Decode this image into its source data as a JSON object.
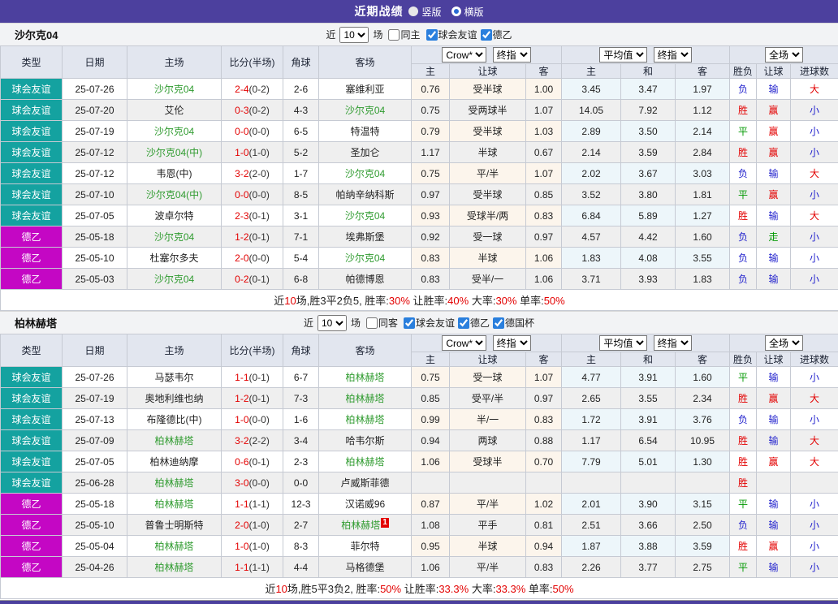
{
  "topbar": {
    "title": "近期战绩",
    "layout_options": [
      {
        "label": "竖版",
        "selected": true
      },
      {
        "label": "横版",
        "selected": false
      }
    ]
  },
  "palette": {
    "topbar_purple": "#4c409e",
    "type_friendly_teal": "#14a2a0",
    "type_league_magenta": "#c407c4",
    "focus_team_green": "#2f9b2f",
    "score_red": "#e30000",
    "result_red": "#e30000",
    "result_blue": "#2323cd",
    "result_green": "#029902",
    "crow_col_bg": "#fcf5ec",
    "avg_col_bg": "#edf6fa"
  },
  "head": {
    "type": "类型",
    "date": "日期",
    "home": "主场",
    "score": "比分(半场)",
    "corner": "角球",
    "away": "客场",
    "crow_home": "主",
    "crow_handicap": "让球",
    "crow_away": "客",
    "avg_home": "主",
    "avg_draw": "和",
    "avg_away": "客",
    "result_wl": "胜负",
    "result_handicap": "让球",
    "result_goals": "进球数",
    "crow_select": "Crow*",
    "final_select": "终指",
    "avg_select": "平均值",
    "scope_select": "全场"
  },
  "sections": [
    {
      "team": "沙尔克04",
      "controls": {
        "near": "近",
        "count": "10",
        "suffix": "场",
        "same": "同主",
        "leagues": [
          {
            "label": "球会友谊",
            "checked": true
          },
          {
            "label": "德乙",
            "checked": true
          }
        ]
      },
      "rows": [
        {
          "type": "球会友谊",
          "date": "25-07-26",
          "home": "沙尔克04",
          "home_green": true,
          "score": "2-4",
          "half": "(0-2)",
          "corner": "2-6",
          "away": "塞维利亚",
          "away_green": false,
          "away_badge": "",
          "crow": [
            "0.76",
            "受半球",
            "1.00"
          ],
          "avg": [
            "3.45",
            "3.47",
            "1.97"
          ],
          "res": [
            "负",
            "输",
            "大"
          ]
        },
        {
          "type": "球会友谊",
          "date": "25-07-20",
          "home": "艾伦",
          "home_green": false,
          "score": "0-3",
          "half": "(0-2)",
          "corner": "4-3",
          "away": "沙尔克04",
          "away_green": true,
          "away_badge": "",
          "crow": [
            "0.75",
            "受两球半",
            "1.07"
          ],
          "avg": [
            "14.05",
            "7.92",
            "1.12"
          ],
          "res": [
            "胜",
            "赢",
            "小"
          ]
        },
        {
          "type": "球会友谊",
          "date": "25-07-19",
          "home": "沙尔克04",
          "home_green": true,
          "score": "0-0",
          "half": "(0-0)",
          "corner": "6-5",
          "away": "特温特",
          "away_green": false,
          "away_badge": "",
          "crow": [
            "0.79",
            "受半球",
            "1.03"
          ],
          "avg": [
            "2.89",
            "3.50",
            "2.14"
          ],
          "res": [
            "平",
            "赢",
            "小"
          ]
        },
        {
          "type": "球会友谊",
          "date": "25-07-12",
          "home": "沙尔克04(中)",
          "home_green": true,
          "score": "1-0",
          "half": "(1-0)",
          "corner": "5-2",
          "away": "圣加仑",
          "away_green": false,
          "away_badge": "",
          "crow": [
            "1.17",
            "半球",
            "0.67"
          ],
          "avg": [
            "2.14",
            "3.59",
            "2.84"
          ],
          "res": [
            "胜",
            "赢",
            "小"
          ]
        },
        {
          "type": "球会友谊",
          "date": "25-07-12",
          "home": "韦恩(中)",
          "home_green": false,
          "score": "3-2",
          "half": "(2-0)",
          "corner": "1-7",
          "away": "沙尔克04",
          "away_green": true,
          "away_badge": "",
          "crow": [
            "0.75",
            "平/半",
            "1.07"
          ],
          "avg": [
            "2.02",
            "3.67",
            "3.03"
          ],
          "res": [
            "负",
            "输",
            "大"
          ]
        },
        {
          "type": "球会友谊",
          "date": "25-07-10",
          "home": "沙尔克04(中)",
          "home_green": true,
          "score": "0-0",
          "half": "(0-0)",
          "corner": "8-5",
          "away": "帕纳辛纳科斯",
          "away_green": false,
          "away_badge": "",
          "crow": [
            "0.97",
            "受半球",
            "0.85"
          ],
          "avg": [
            "3.52",
            "3.80",
            "1.81"
          ],
          "res": [
            "平",
            "赢",
            "小"
          ]
        },
        {
          "type": "球会友谊",
          "date": "25-07-05",
          "home": "波卓尔特",
          "home_green": false,
          "score": "2-3",
          "half": "(0-1)",
          "corner": "3-1",
          "away": "沙尔克04",
          "away_green": true,
          "away_badge": "",
          "crow": [
            "0.93",
            "受球半/两",
            "0.83"
          ],
          "avg": [
            "6.84",
            "5.89",
            "1.27"
          ],
          "res": [
            "胜",
            "输",
            "大"
          ]
        },
        {
          "type": "德乙",
          "date": "25-05-18",
          "home": "沙尔克04",
          "home_green": true,
          "score": "1-2",
          "half": "(0-1)",
          "corner": "7-1",
          "away": "埃弗斯堡",
          "away_green": false,
          "away_badge": "",
          "crow": [
            "0.92",
            "受一球",
            "0.97"
          ],
          "avg": [
            "4.57",
            "4.42",
            "1.60"
          ],
          "res": [
            "负",
            "走",
            "小"
          ]
        },
        {
          "type": "德乙",
          "date": "25-05-10",
          "home": "杜塞尔多夫",
          "home_green": false,
          "score": "2-0",
          "half": "(0-0)",
          "corner": "5-4",
          "away": "沙尔克04",
          "away_green": true,
          "away_badge": "",
          "crow": [
            "0.83",
            "半球",
            "1.06"
          ],
          "avg": [
            "1.83",
            "4.08",
            "3.55"
          ],
          "res": [
            "负",
            "输",
            "小"
          ]
        },
        {
          "type": "德乙",
          "date": "25-05-03",
          "home": "沙尔克04",
          "home_green": true,
          "score": "0-2",
          "half": "(0-1)",
          "corner": "6-8",
          "away": "帕德博恩",
          "away_green": false,
          "away_badge": "",
          "crow": [
            "0.83",
            "受半/一",
            "1.06"
          ],
          "avg": [
            "3.71",
            "3.93",
            "1.83"
          ],
          "res": [
            "负",
            "输",
            "小"
          ]
        }
      ],
      "summary": [
        {
          "t": "近"
        },
        {
          "t": "10",
          "red": true
        },
        {
          "t": "场,胜3平2负5, 胜率:"
        },
        {
          "t": "30%",
          "red": true
        },
        {
          "t": " 让胜率:"
        },
        {
          "t": "40%",
          "red": true
        },
        {
          "t": " 大率:"
        },
        {
          "t": "30%",
          "red": true
        },
        {
          "t": " 单率:"
        },
        {
          "t": "50%",
          "red": true
        }
      ]
    },
    {
      "team": "柏林赫塔",
      "controls": {
        "near": "近",
        "count": "10",
        "suffix": "场",
        "same": "同客",
        "leagues": [
          {
            "label": "球会友谊",
            "checked": true
          },
          {
            "label": "德乙",
            "checked": true
          },
          {
            "label": "德国杯",
            "checked": true
          }
        ]
      },
      "rows": [
        {
          "type": "球会友谊",
          "date": "25-07-26",
          "home": "马瑟韦尔",
          "home_green": false,
          "score": "1-1",
          "half": "(0-1)",
          "corner": "6-7",
          "away": "柏林赫塔",
          "away_green": true,
          "away_badge": "",
          "crow": [
            "0.75",
            "受一球",
            "1.07"
          ],
          "avg": [
            "4.77",
            "3.91",
            "1.60"
          ],
          "res": [
            "平",
            "输",
            "小"
          ]
        },
        {
          "type": "球会友谊",
          "date": "25-07-19",
          "home": "奥地利维也纳",
          "home_green": false,
          "score": "1-2",
          "half": "(0-1)",
          "corner": "7-3",
          "away": "柏林赫塔",
          "away_green": true,
          "away_badge": "",
          "crow": [
            "0.85",
            "受平/半",
            "0.97"
          ],
          "avg": [
            "2.65",
            "3.55",
            "2.34"
          ],
          "res": [
            "胜",
            "赢",
            "大"
          ]
        },
        {
          "type": "球会友谊",
          "date": "25-07-13",
          "home": "布隆德比(中)",
          "home_green": false,
          "score": "1-0",
          "half": "(0-0)",
          "corner": "1-6",
          "away": "柏林赫塔",
          "away_green": true,
          "away_badge": "",
          "crow": [
            "0.99",
            "半/一",
            "0.83"
          ],
          "avg": [
            "1.72",
            "3.91",
            "3.76"
          ],
          "res": [
            "负",
            "输",
            "小"
          ]
        },
        {
          "type": "球会友谊",
          "date": "25-07-09",
          "home": "柏林赫塔",
          "home_green": true,
          "score": "3-2",
          "half": "(2-2)",
          "corner": "3-4",
          "away": "哈韦尔斯",
          "away_green": false,
          "away_badge": "",
          "crow": [
            "0.94",
            "两球",
            "0.88"
          ],
          "avg": [
            "1.17",
            "6.54",
            "10.95"
          ],
          "res": [
            "胜",
            "输",
            "大"
          ]
        },
        {
          "type": "球会友谊",
          "date": "25-07-05",
          "home": "柏林迪纳摩",
          "home_green": false,
          "score": "0-6",
          "half": "(0-1)",
          "corner": "2-3",
          "away": "柏林赫塔",
          "away_green": true,
          "away_badge": "",
          "crow": [
            "1.06",
            "受球半",
            "0.70"
          ],
          "avg": [
            "7.79",
            "5.01",
            "1.30"
          ],
          "res": [
            "胜",
            "赢",
            "大"
          ]
        },
        {
          "type": "球会友谊",
          "date": "25-06-28",
          "home": "柏林赫塔",
          "home_green": true,
          "score": "3-0",
          "half": "(0-0)",
          "corner": "0-0",
          "away": "卢威斯菲德",
          "away_green": false,
          "away_badge": "",
          "crow": [
            "",
            "",
            ""
          ],
          "avg": [
            "",
            "",
            ""
          ],
          "res": [
            "胜",
            "",
            ""
          ]
        },
        {
          "type": "德乙",
          "date": "25-05-18",
          "home": "柏林赫塔",
          "home_green": true,
          "score": "1-1",
          "half": "(1-1)",
          "corner": "12-3",
          "away": "汉诺威96",
          "away_green": false,
          "away_badge": "",
          "crow": [
            "0.87",
            "平/半",
            "1.02"
          ],
          "avg": [
            "2.01",
            "3.90",
            "3.15"
          ],
          "res": [
            "平",
            "输",
            "小"
          ]
        },
        {
          "type": "德乙",
          "date": "25-05-10",
          "home": "普鲁士明斯特",
          "home_green": false,
          "score": "2-0",
          "half": "(1-0)",
          "corner": "2-7",
          "away": "柏林赫塔",
          "away_green": true,
          "away_badge": "1",
          "crow": [
            "1.08",
            "平手",
            "0.81"
          ],
          "avg": [
            "2.51",
            "3.66",
            "2.50"
          ],
          "res": [
            "负",
            "输",
            "小"
          ]
        },
        {
          "type": "德乙",
          "date": "25-05-04",
          "home": "柏林赫塔",
          "home_green": true,
          "score": "1-0",
          "half": "(1-0)",
          "corner": "8-3",
          "away": "菲尔特",
          "away_green": false,
          "away_badge": "",
          "crow": [
            "0.95",
            "半球",
            "0.94"
          ],
          "avg": [
            "1.87",
            "3.88",
            "3.59"
          ],
          "res": [
            "胜",
            "赢",
            "小"
          ]
        },
        {
          "type": "德乙",
          "date": "25-04-26",
          "home": "柏林赫塔",
          "home_green": true,
          "score": "1-1",
          "half": "(1-1)",
          "corner": "4-4",
          "away": "马格德堡",
          "away_green": false,
          "away_badge": "",
          "crow": [
            "1.06",
            "平/半",
            "0.83"
          ],
          "avg": [
            "2.26",
            "3.77",
            "2.75"
          ],
          "res": [
            "平",
            "输",
            "小"
          ]
        }
      ],
      "summary": [
        {
          "t": "近"
        },
        {
          "t": "10",
          "red": true
        },
        {
          "t": "场,胜5平3负2, 胜率:"
        },
        {
          "t": "50%",
          "red": true
        },
        {
          "t": " 让胜率:"
        },
        {
          "t": "33.3%",
          "red": true
        },
        {
          "t": " 大率:"
        },
        {
          "t": "33.3%",
          "red": true
        },
        {
          "t": " 单率:"
        },
        {
          "t": "50%",
          "red": true
        }
      ]
    }
  ]
}
